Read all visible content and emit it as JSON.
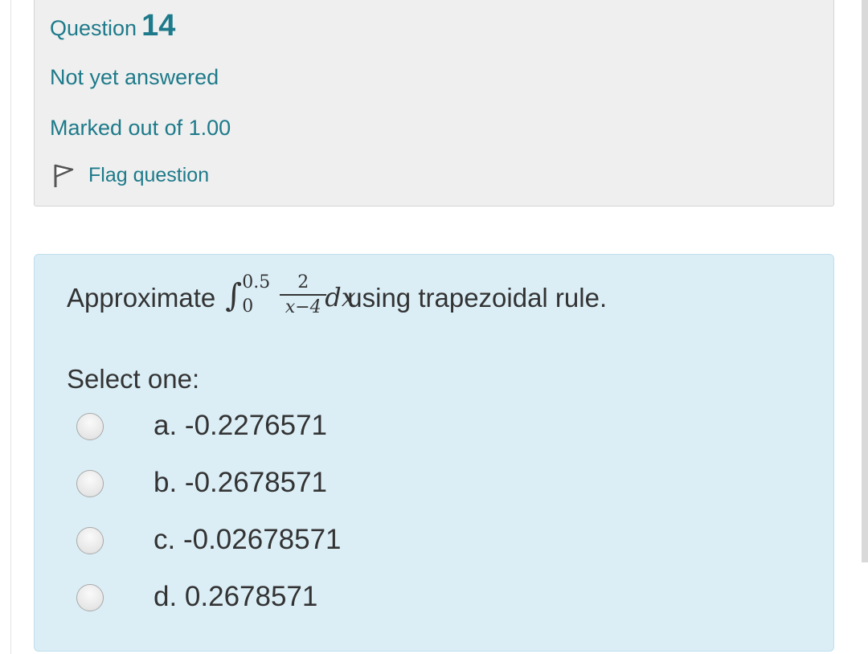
{
  "question_info": {
    "label": "Question",
    "number": "14",
    "state": "Not yet answered",
    "grade": "Marked out of 1.00",
    "flag_label": "Flag question",
    "accent_color": "#1d7a8a"
  },
  "question": {
    "prefix": "Approximate",
    "formula": {
      "integral_sign": "∫",
      "upper_limit": "0.5",
      "lower_limit": "0",
      "numerator": "2",
      "denominator": "x−4",
      "differential": "dx"
    },
    "suffix": "using trapezoidal rule.",
    "prompt": "Select one:",
    "background_color": "#dbeef6"
  },
  "options": [
    {
      "label": "a. -0.2276571",
      "selected": false
    },
    {
      "label": "b. -0.2678571",
      "selected": false
    },
    {
      "label": "c. -0.02678571",
      "selected": false
    },
    {
      "label": "d. 0.2678571",
      "selected": false
    }
  ],
  "icons": {
    "flag": "flag-icon",
    "radio": "radio-unchecked-icon"
  }
}
